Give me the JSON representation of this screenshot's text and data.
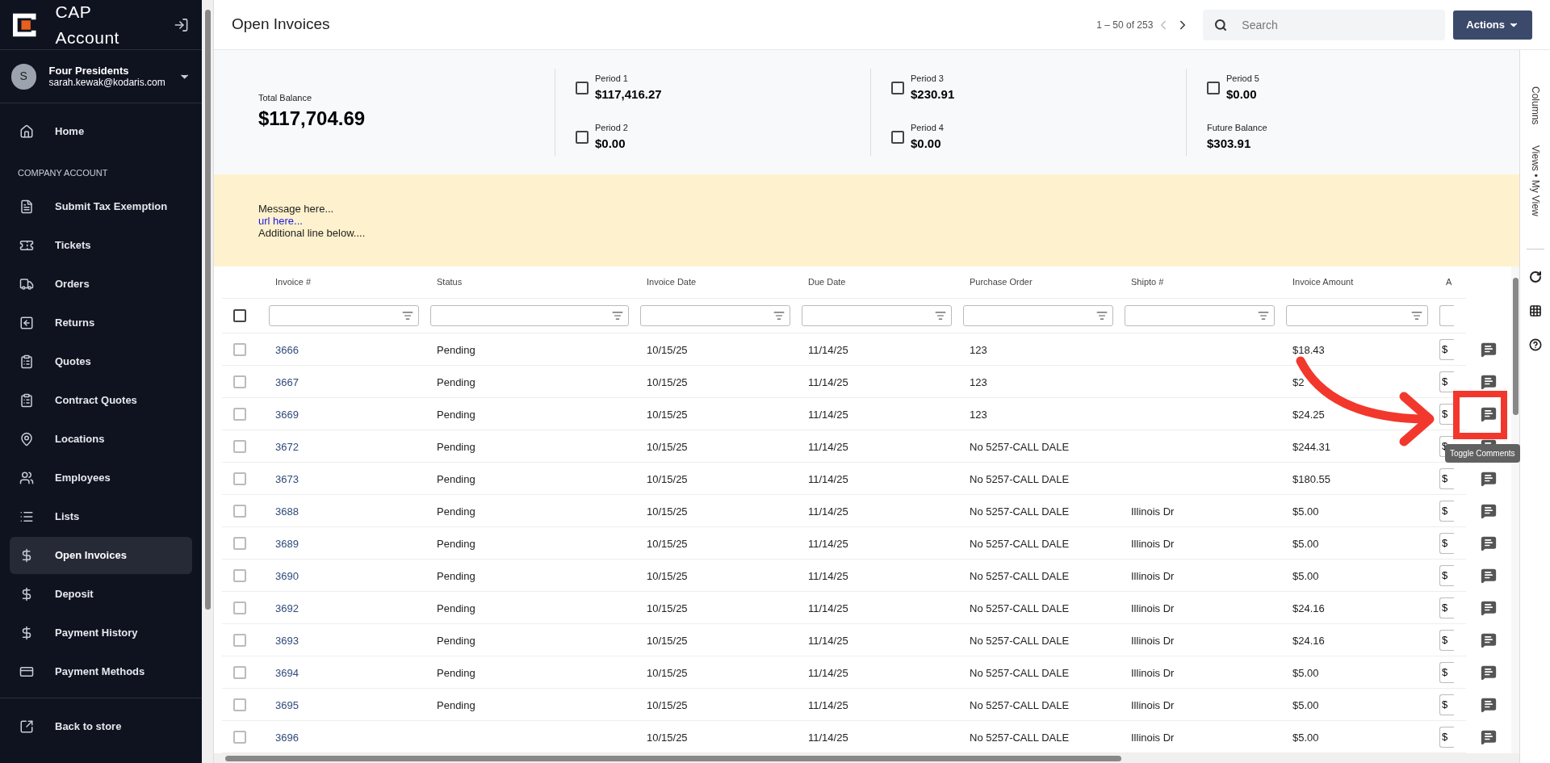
{
  "sidebar": {
    "title": "CAP Account",
    "user": {
      "initial": "S",
      "name": "Four Presidents",
      "email": "sarah.kewak@kodaris.com"
    },
    "home": {
      "label": "Home",
      "selected": false
    },
    "section": "COMPANY ACCOUNT",
    "items": [
      {
        "label": "Submit Tax Exemption",
        "selected": false
      },
      {
        "label": "Tickets",
        "selected": false
      },
      {
        "label": "Orders",
        "selected": false
      },
      {
        "label": "Returns",
        "selected": false
      },
      {
        "label": "Quotes",
        "selected": false
      },
      {
        "label": "Contract Quotes",
        "selected": false
      },
      {
        "label": "Locations",
        "selected": false
      },
      {
        "label": "Employees",
        "selected": false
      },
      {
        "label": "Lists",
        "selected": false
      },
      {
        "label": "Open Invoices",
        "selected": true
      },
      {
        "label": "Deposit",
        "selected": false
      },
      {
        "label": "Payment History",
        "selected": false
      },
      {
        "label": "Payment Methods",
        "selected": false
      }
    ],
    "footer": "Back to store"
  },
  "header": {
    "title": "Open Invoices",
    "pagination": "1 – 50 of 253",
    "search": {
      "placeholder": "Search"
    },
    "actions": "Actions"
  },
  "summary": {
    "total": {
      "label": "Total Balance",
      "value": "$117,704.69"
    },
    "periods": [
      {
        "label": "Period 1",
        "value": "$117,416.27",
        "checked": false
      },
      {
        "label": "Period 2",
        "value": "$0.00",
        "checked": false
      },
      {
        "label": "Period 3",
        "value": "$230.91",
        "checked": false
      },
      {
        "label": "Period 4",
        "value": "$0.00",
        "checked": false
      },
      {
        "label": "Period 5",
        "value": "$0.00",
        "checked": false
      }
    ],
    "future": {
      "label": "Future Balance",
      "value": "$303.91"
    }
  },
  "banner": {
    "message": "Message here...",
    "link": "url here...",
    "extra": "Additional line below...."
  },
  "table": {
    "select_all": {
      "checked": false
    },
    "columns": [
      "Invoice #",
      "Status",
      "Invoice Date",
      "Due Date",
      "Purchase Order",
      "Shipto #",
      "Invoice Amount",
      "A"
    ],
    "rows": [
      {
        "checked": false,
        "cells": [
          "3666",
          "Pending",
          "10/15/25",
          "11/14/25",
          "123",
          "",
          "$18.43",
          "$"
        ]
      },
      {
        "checked": false,
        "cells": [
          "3667",
          "Pending",
          "10/15/25",
          "11/14/25",
          "123",
          "",
          "$2",
          "$"
        ]
      },
      {
        "checked": false,
        "cells": [
          "3669",
          "Pending",
          "10/15/25",
          "11/14/25",
          "123",
          "",
          "$24.25",
          "$"
        ]
      },
      {
        "checked": false,
        "cells": [
          "3672",
          "Pending",
          "10/15/25",
          "11/14/25",
          "No 5257-CALL DALE",
          "",
          "$244.31",
          "$"
        ]
      },
      {
        "checked": false,
        "cells": [
          "3673",
          "Pending",
          "10/15/25",
          "11/14/25",
          "No 5257-CALL DALE",
          "",
          "$180.55",
          "$"
        ]
      },
      {
        "checked": false,
        "cells": [
          "3688",
          "Pending",
          "10/15/25",
          "11/14/25",
          "No 5257-CALL DALE",
          "Illinois Dr",
          "$5.00",
          "$"
        ]
      },
      {
        "checked": false,
        "cells": [
          "3689",
          "Pending",
          "10/15/25",
          "11/14/25",
          "No 5257-CALL DALE",
          "Illinois Dr",
          "$5.00",
          "$"
        ]
      },
      {
        "checked": false,
        "cells": [
          "3690",
          "Pending",
          "10/15/25",
          "11/14/25",
          "No 5257-CALL DALE",
          "Illinois Dr",
          "$5.00",
          "$"
        ]
      },
      {
        "checked": false,
        "cells": [
          "3692",
          "Pending",
          "10/15/25",
          "11/14/25",
          "No 5257-CALL DALE",
          "Illinois Dr",
          "$24.16",
          "$"
        ]
      },
      {
        "checked": false,
        "cells": [
          "3693",
          "Pending",
          "10/15/25",
          "11/14/25",
          "No 5257-CALL DALE",
          "Illinois Dr",
          "$24.16",
          "$"
        ]
      },
      {
        "checked": false,
        "cells": [
          "3694",
          "Pending",
          "10/15/25",
          "11/14/25",
          "No 5257-CALL DALE",
          "Illinois Dr",
          "$5.00",
          "$"
        ]
      },
      {
        "checked": false,
        "cells": [
          "3695",
          "Pending",
          "10/15/25",
          "11/14/25",
          "No 5257-CALL DALE",
          "Illinois Dr",
          "$5.00",
          "$"
        ]
      },
      {
        "checked": false,
        "cells": [
          "3696",
          "",
          "10/15/25",
          "11/14/25",
          "No 5257-CALL DALE",
          "Illinois Dr",
          "$5.00",
          "$"
        ]
      }
    ]
  },
  "tooltip": "Toggle Comments",
  "side_panel": {
    "columns": "Columns",
    "views": "Views • My View"
  }
}
